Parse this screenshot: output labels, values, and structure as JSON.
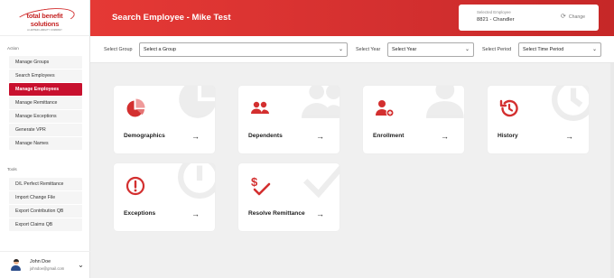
{
  "brand": {
    "name": "total benefit solutions",
    "tagline": "A LIMITED LIABILITY COMPANY"
  },
  "sidebar": {
    "action_label": "Action",
    "action_items": [
      {
        "label": "Manage Groups"
      },
      {
        "label": "Search Employees"
      },
      {
        "label": "Manage Employees",
        "active": true
      },
      {
        "label": "Manage Remittance"
      },
      {
        "label": "Manage Exceptions"
      },
      {
        "label": "Generate VPR"
      },
      {
        "label": "Manage Names"
      }
    ],
    "tools_label": "Tools",
    "tool_items": [
      {
        "label": "D/L Perfect Remittance"
      },
      {
        "label": "Import Change File"
      },
      {
        "label": "Export Contribution QB"
      },
      {
        "label": "Export Claims QB"
      }
    ]
  },
  "user": {
    "name": "John Doe",
    "email": "johndoe@gmail.com"
  },
  "header": {
    "title": "Search Employee - Mike Test",
    "selected_employee_label": "Selected Employee",
    "selected_employee_value": "8821 - Chandler",
    "change_label": "Change"
  },
  "filters": {
    "group_label": "Select Group",
    "group_value": "Select a Group",
    "year_label": "Select Year",
    "year_value": "Select Year",
    "period_label": "Select Period",
    "period_value": "Select Time Period"
  },
  "cards": [
    {
      "label": "Demographics",
      "icon": "pie-chart-icon"
    },
    {
      "label": "Dependents",
      "icon": "users-icon"
    },
    {
      "label": "Enrollment",
      "icon": "user-plus-icon"
    },
    {
      "label": "History",
      "icon": "history-icon"
    },
    {
      "label": "Exceptions",
      "icon": "alert-circle-icon"
    },
    {
      "label": "Resolve Remittance",
      "icon": "dollar-check-icon"
    }
  ],
  "colors": {
    "accent": "#c8102e",
    "header": "#d32f2f",
    "icon": "#d32f2f"
  }
}
